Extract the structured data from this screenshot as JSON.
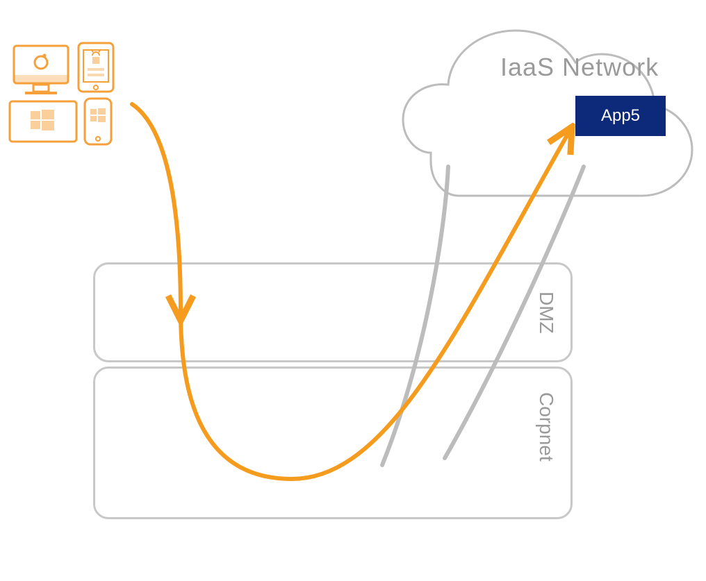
{
  "cloud": {
    "title": "IaaS Network",
    "app_label": "App5"
  },
  "zones": {
    "dmz_label": "DMZ",
    "corpnet_label": "Corpnet"
  },
  "colors": {
    "orange": "#f59b1e",
    "gray": "#bcbcbc",
    "blue": "#0d2a7a",
    "label_gray": "#9a9a9a"
  }
}
